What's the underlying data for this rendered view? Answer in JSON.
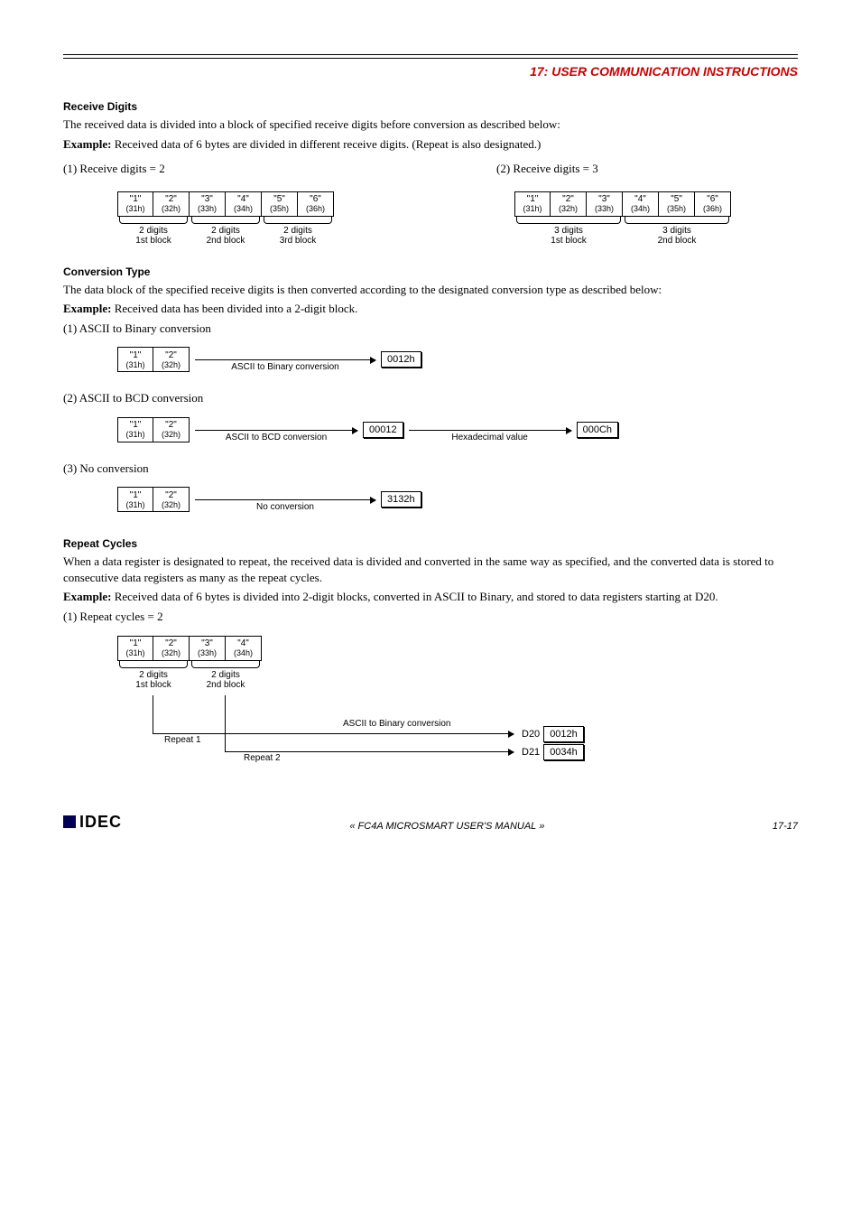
{
  "chapter": {
    "num": "17:",
    "title_pre": "U",
    "title_rest": "SER ",
    "title2_pre": "C",
    "title2_rest": "OMMUNICATION ",
    "title3_pre": "I",
    "title3_rest": "NSTRUCTIONS"
  },
  "s1": {
    "head": "Receive Digits",
    "p1": "The received data is divided into a block of specified receive digits before conversion as described below:",
    "ex_label": "Example:",
    "ex_text": " Received data of 6 bytes are divided in different receive digits. (Repeat is also designated.)",
    "case1": "(1) Receive digits = 2",
    "case2": "(2) Receive digits = 3",
    "cells": [
      {
        "c": "\"1\"",
        "h": "(31h)"
      },
      {
        "c": "\"2\"",
        "h": "(32h)"
      },
      {
        "c": "\"3\"",
        "h": "(33h)"
      },
      {
        "c": "\"4\"",
        "h": "(34h)"
      },
      {
        "c": "\"5\"",
        "h": "(35h)"
      },
      {
        "c": "\"6\"",
        "h": "(36h)"
      }
    ],
    "b2": [
      {
        "d": "2 digits",
        "b": "1st block"
      },
      {
        "d": "2 digits",
        "b": "2nd block"
      },
      {
        "d": "2 digits",
        "b": "3rd block"
      }
    ],
    "b3": [
      {
        "d": "3 digits",
        "b": "1st block"
      },
      {
        "d": "3 digits",
        "b": "2nd block"
      }
    ]
  },
  "s2": {
    "head": "Conversion Type",
    "p1": "The data block of the specified receive digits is then converted according to the designated conversion type as described below:",
    "ex_label": "Example:",
    "ex_text": " Received data has been divided into a 2-digit block.",
    "c1": "(1) ASCII to Binary conversion",
    "c2": "(2) ASCII to BCD conversion",
    "c3": "(3) No conversion",
    "pair": [
      {
        "c": "\"1\"",
        "h": "(31h)"
      },
      {
        "c": "\"2\"",
        "h": "(32h)"
      }
    ],
    "lab1": "ASCII to Binary conversion",
    "res1": "0012h",
    "lab2a": "ASCII to BCD conversion",
    "res2a": "00012",
    "lab2b": "Hexadecimal value",
    "res2b": "000Ch",
    "lab3": "No conversion",
    "res3": "3132h"
  },
  "s3": {
    "head": "Repeat Cycles",
    "p1": "When a data register is designated to repeat, the received data is divided and converted in the same way as specified, and the converted data is stored to consecutive data registers as many as the repeat cycles.",
    "ex_label": "Example:",
    "ex_text": " Received data of 6 bytes is divided into 2-digit blocks, converted in ASCII to Binary, and stored to data registers starting at D20.",
    "case1": "(1) Repeat cycles = 2",
    "cells": [
      {
        "c": "\"1\"",
        "h": "(31h)"
      },
      {
        "c": "\"2\"",
        "h": "(32h)"
      },
      {
        "c": "\"3\"",
        "h": "(33h)"
      },
      {
        "c": "\"4\"",
        "h": "(34h)"
      }
    ],
    "b": [
      {
        "d": "2 digits",
        "b": "1st block"
      },
      {
        "d": "2 digits",
        "b": "2nd block"
      }
    ],
    "rep1": "Repeat 1",
    "rep2": "Repeat 2",
    "conv": "ASCII to Binary conversion",
    "reg1": "D20",
    "val1": "0012h",
    "reg2": "D21",
    "val2": "0034h"
  },
  "footer": {
    "logo": "IDEC",
    "center_pre": "« FC4A M",
    "center_sc1": "ICRO",
    "center_mid": "S",
    "center_sc2": "MART",
    "center_mid2": " U",
    "center_sc3": "SER",
    "center_mid3": "'",
    "center_sc4": "S",
    "center_mid4": " M",
    "center_sc5": "ANUAL",
    "center_end": " »",
    "page": "17-17"
  }
}
